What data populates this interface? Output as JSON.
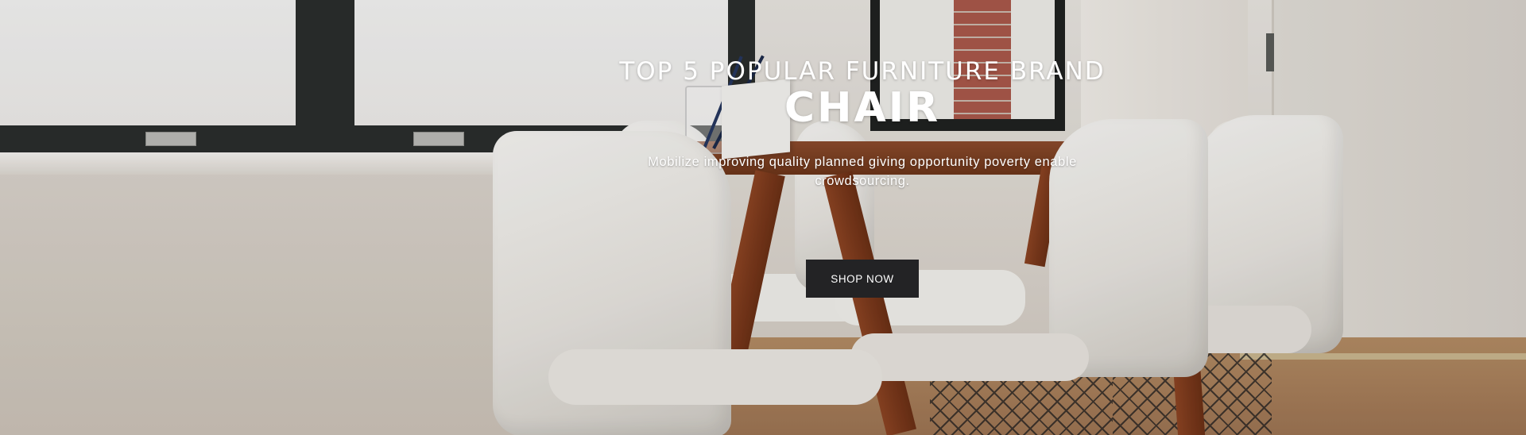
{
  "hero": {
    "eyebrow": "TOP 5 POPULAR FURNITURE BRAND",
    "headline": "CHAIR",
    "description": "Mobilize improving quality planned giving opportunity poverty enable crowdsourcing.",
    "cta_label": "SHOP NOW"
  },
  "colors": {
    "text": "#ffffff",
    "button_background": "#232325",
    "button_text": "#ffffff"
  },
  "background_image": "dining-table-with-white-chairs"
}
